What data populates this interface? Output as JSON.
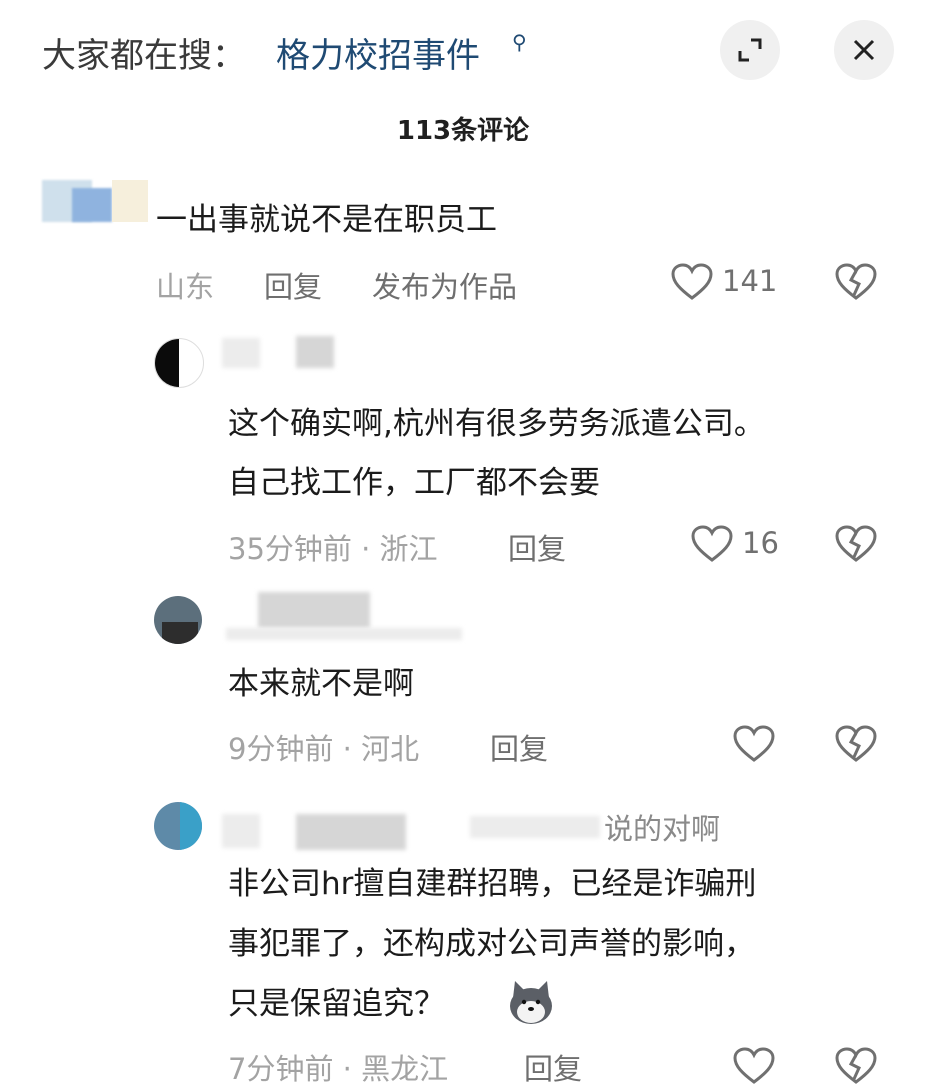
{
  "header": {
    "search_prefix": "大家都在搜：",
    "search_term": "格力校招事件",
    "search_glyph": "⚲"
  },
  "comments_title": "113条评论",
  "comments": [
    {
      "text": "一出事就说不是在职员工",
      "location": "山东",
      "reply_label": "回复",
      "publish_label": "发布为作品",
      "likes": "141"
    }
  ],
  "replies": [
    {
      "text_line1": "这个确实啊,杭州有很多劳务派遣公司。",
      "text_line2": "自己找工作，工厂都不会要",
      "time": "35分钟前 · 浙江",
      "reply_label": "回复",
      "likes": "16"
    },
    {
      "text_line1": "本来就不是啊",
      "time": "9分钟前 · 河北",
      "reply_label": "回复",
      "likes": ""
    },
    {
      "username_partial": "说的对啊",
      "text_line1": "非公司hr擅自建群招聘，已经是诈骗刑",
      "text_line2": "事犯罪了，还构成对公司声誉的影响，",
      "text_line3": "只是保留追究？",
      "time": "7分钟前 · 黑龙江",
      "reply_label": "回复",
      "likes": ""
    }
  ],
  "colors": {
    "accent_link": "#1f4a73",
    "meta_gray": "#a3a3a3",
    "icon_gray": "#6f6f6f"
  }
}
